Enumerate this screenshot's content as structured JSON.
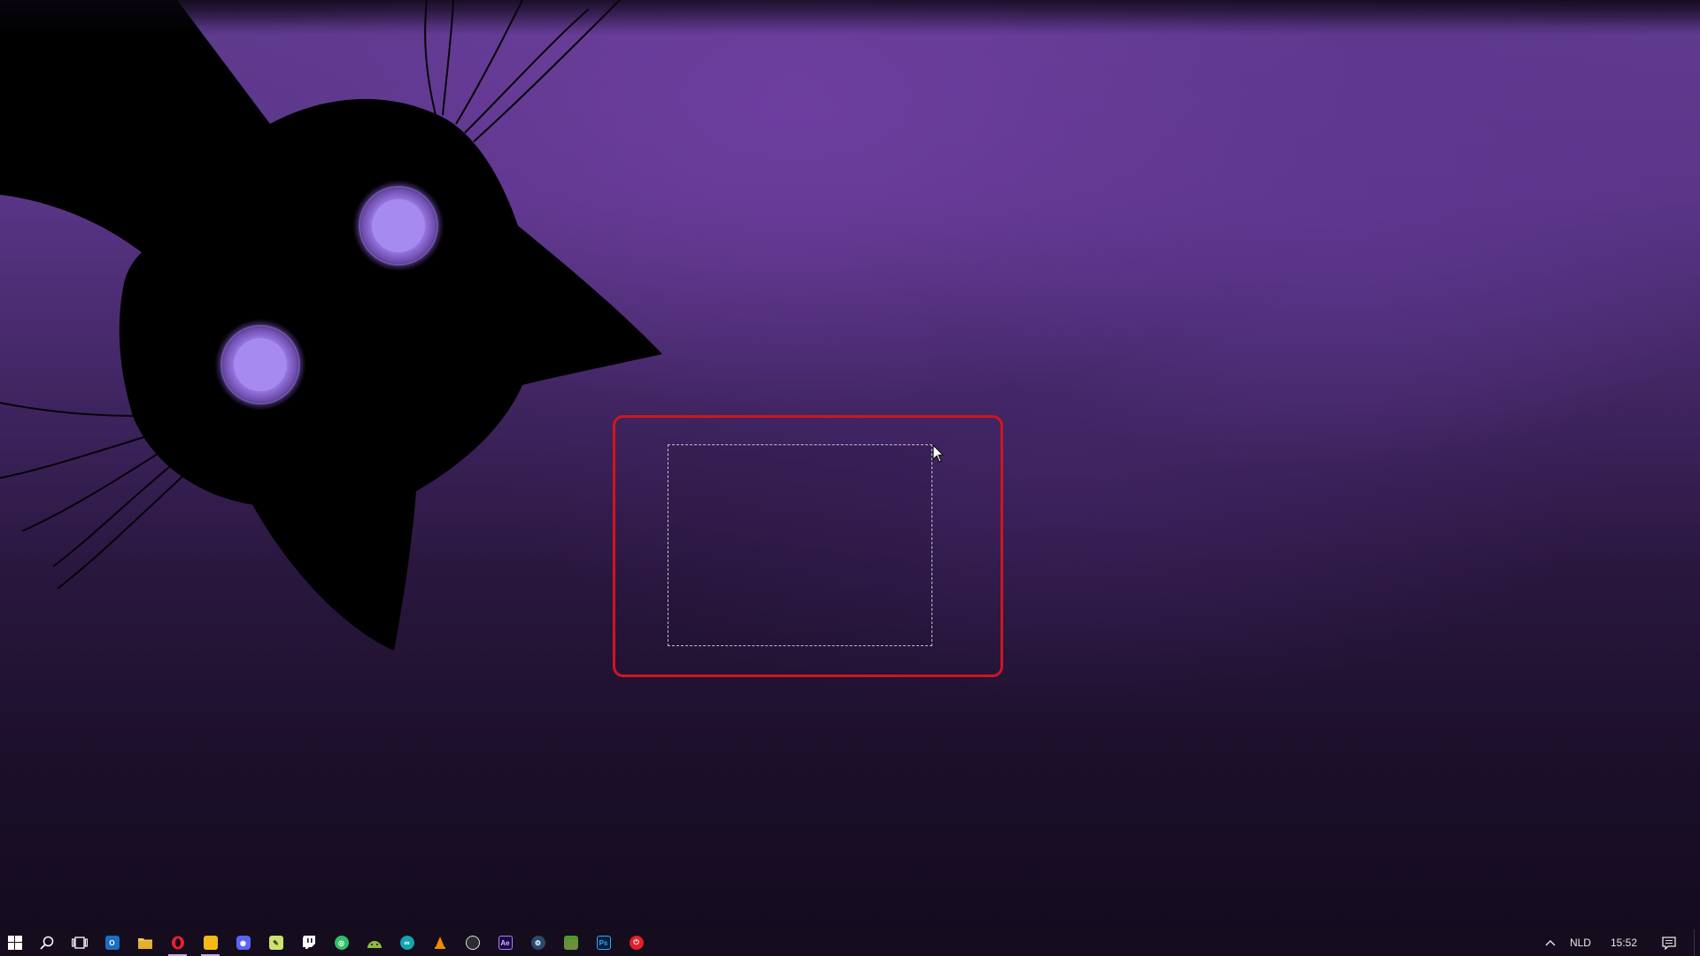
{
  "taskbar": {
    "apps": [
      {
        "name": "cortana-search-icon"
      },
      {
        "name": "task-view-icon"
      },
      {
        "name": "outlook-icon"
      },
      {
        "name": "file-explorer-icon"
      },
      {
        "name": "opera-icon",
        "active": true
      },
      {
        "name": "sticky-app-icon",
        "active": true
      },
      {
        "name": "discord-icon"
      },
      {
        "name": "notepad-icon"
      },
      {
        "name": "twitch-icon"
      },
      {
        "name": "globe-app-icon"
      },
      {
        "name": "android-icon"
      },
      {
        "name": "arduino-icon"
      },
      {
        "name": "vlc-icon"
      },
      {
        "name": "obs-icon"
      },
      {
        "name": "after-effects-icon",
        "label": "Ae"
      },
      {
        "name": "steam-icon"
      },
      {
        "name": "minecraft-icon"
      },
      {
        "name": "photoshop-icon",
        "label": "Ps"
      },
      {
        "name": "power-app-icon"
      }
    ],
    "tray": {
      "language": "NLD",
      "time": "15:52"
    }
  },
  "colors": {
    "highlight": "#d0161d",
    "cat_eye": "#9b7be6",
    "taskbar_bg": "#150d1d"
  }
}
